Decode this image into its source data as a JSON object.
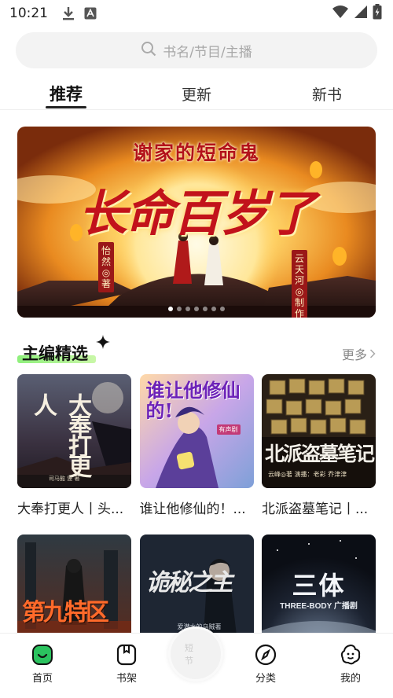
{
  "status_bar": {
    "time": "10:21",
    "icons": [
      "download-icon",
      "accessibility-a-icon",
      "wifi-icon",
      "signal-icon",
      "battery-charging-icon"
    ]
  },
  "search": {
    "placeholder": "书名/节目/主播"
  },
  "tabs": [
    {
      "label": "推荐",
      "active": true
    },
    {
      "label": "更新",
      "active": false
    },
    {
      "label": "新书",
      "active": false
    }
  ],
  "banner": {
    "subtitle": "谢家的短命鬼",
    "title": "长命百岁了",
    "author_left": "怡然◎著",
    "author_right": "云天河◎制作",
    "dot_count": 7,
    "active_dot": 0
  },
  "section": {
    "title": "主编精选",
    "more": "更多"
  },
  "books_row1": [
    {
      "title": "大奉打更人丨头...",
      "cover_text": "大奉打更人",
      "cover_sub": "司马懿 狸 著"
    },
    {
      "title": "谁让他修仙的！...",
      "cover_text": "谁让他修仙的!",
      "cover_sub": "有声剧"
    },
    {
      "title": "北派盗墓笔记丨...",
      "cover_text": "北派盗墓笔记",
      "cover_sub": "云峰◎著  演播：老彩 乔津津"
    }
  ],
  "books_row2": [
    {
      "cover_text": "第九特区",
      "cover_sub": ""
    },
    {
      "cover_text": "诡秘之主",
      "cover_sub": "爱潜水的乌贼著"
    },
    {
      "cover_text": "三体",
      "cover_sub": "THREE-BODY 广播剧"
    }
  ],
  "bottom_nav": [
    {
      "label": "首页",
      "icon": "home-smile-icon",
      "active": true
    },
    {
      "label": "书架",
      "icon": "bookshelf-icon",
      "active": false
    },
    {
      "label": "分类",
      "icon": "compass-icon",
      "active": false
    },
    {
      "label": "我的",
      "icon": "profile-face-icon",
      "active": false
    }
  ],
  "player": {
    "label": "短节"
  },
  "colors": {
    "accent_green": "#2bc35f",
    "banner_red": "#c2121b",
    "text_primary": "#222222",
    "text_secondary": "#888888"
  }
}
